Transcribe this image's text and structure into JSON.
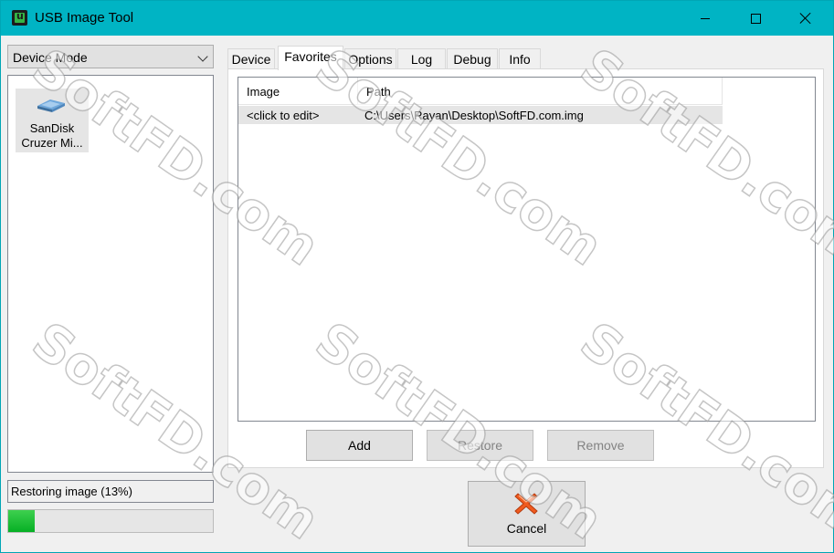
{
  "window": {
    "title": "USB Image Tool"
  },
  "mode_combo": {
    "value": "Device Mode"
  },
  "device_list": [
    {
      "label_line1": "SanDisk",
      "label_line2": "Cruzer Mi..."
    }
  ],
  "status": {
    "text": "Restoring image (13%)",
    "progress": 0.13
  },
  "tabs": [
    {
      "label": "Device"
    },
    {
      "label": "Favorites",
      "active": true
    },
    {
      "label": "Options"
    },
    {
      "label": "Log"
    },
    {
      "label": "Debug"
    },
    {
      "label": "Info"
    }
  ],
  "favorites": {
    "columns": [
      "Image",
      "Path"
    ],
    "rows": [
      {
        "image": "<click to edit>",
        "path": "C:\\Users\\Rayan\\Desktop\\SoftFD.com.img"
      }
    ]
  },
  "buttons": {
    "add": "Add",
    "restore": "Restore",
    "remove": "Remove",
    "cancel": "Cancel"
  },
  "watermark": "SoftFD.com",
  "colors": {
    "titlebar": "#00b4c4",
    "progress": "#06b025",
    "cancel_icon": "#f05a1e"
  }
}
